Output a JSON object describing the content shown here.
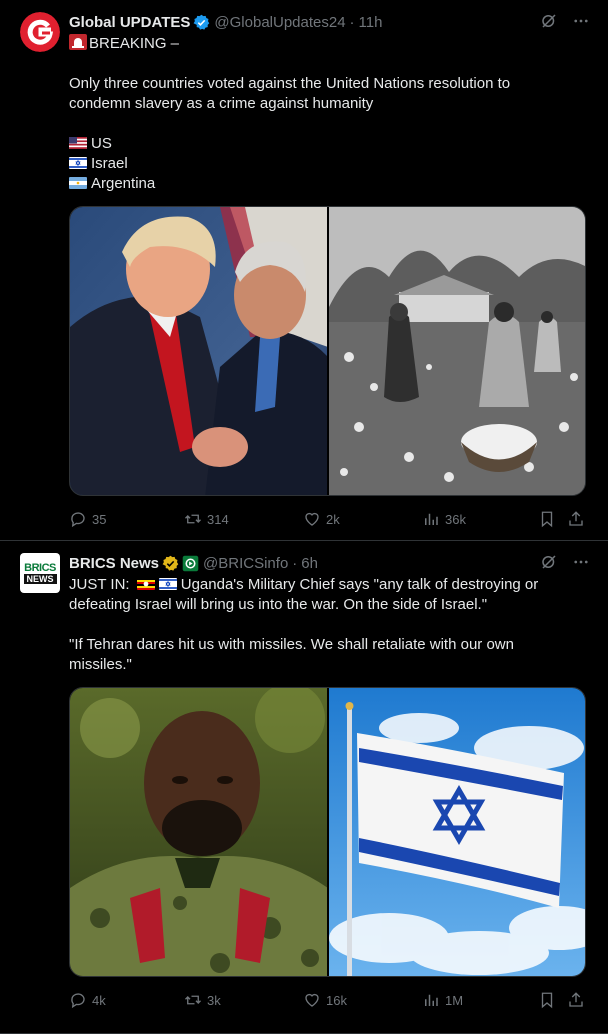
{
  "tweets": [
    {
      "author": "Global UPDATES",
      "handle": "@GlobalUpdates24",
      "dot": "·",
      "time": "11h",
      "lines": [
        "BREAKING –",
        "",
        "Only three countries voted against the United Nations resolution to",
        "condemn slavery as a crime against humanity",
        "",
        "US",
        "Israel",
        "Argentina"
      ],
      "stats": {
        "replies": "35",
        "reposts": "314",
        "likes": "2k",
        "views": "36k"
      }
    },
    {
      "author": "BRICS News",
      "handle": "@BRICSinfo",
      "dot": "·",
      "time": "6h",
      "avatar_text_top": "BRICS",
      "avatar_text_bottom": "NEWS",
      "lines": [
        "JUST IN:",
        "Uganda's Military Chief says \"any talk of destroying or",
        "defeating Israel will bring us into the war. On the side of Israel.\"",
        "",
        "\"If Tehran dares hit us with missiles. We shall retaliate with our own",
        "missiles.\""
      ],
      "stats": {
        "replies": "4k",
        "reposts": "3k",
        "likes": "16k",
        "views": "1M"
      }
    }
  ],
  "colors": {
    "accent": "#1d9bf0",
    "muted": "#71767b",
    "gold": "#e2b719",
    "brand_red": "#e0202f"
  },
  "icons": [
    "grok-icon",
    "more-icon",
    "reply-icon",
    "repost-icon",
    "like-icon",
    "views-icon",
    "bookmark-icon",
    "share-icon",
    "verified-badge-icon",
    "affiliate-badge-icon"
  ]
}
